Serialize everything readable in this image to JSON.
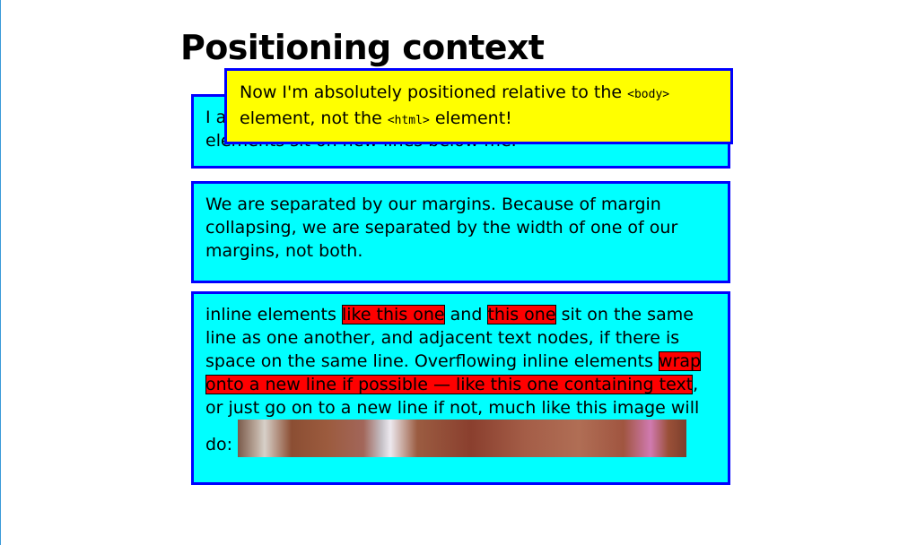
{
  "heading": "Positioning context",
  "block1": {
    "text": "I am a basic block level element. My adjacent block level elements sit on new lines below me."
  },
  "block2": {
    "text": "We are separated by our margins. Because of margin collapsing, we are separated by the width of one of our margins, not both."
  },
  "block3": {
    "t1": "inline elements ",
    "s1": "like this one",
    "t2": " and ",
    "s2": "this one",
    "t3": " sit on the same line as one another, and adjacent text nodes, if there is space on the same line. Overflowing inline elements ",
    "s3": "wrap onto a new line if possible — like this one containing text",
    "t4": ", or just go on to a new line if not, much like this image will do: "
  },
  "positioned": {
    "t1": "Now I'm absolutely positioned relative to the ",
    "c1": "<body>",
    "t2": " element, not the ",
    "c2": "<html>",
    "t3": " element!"
  },
  "colors": {
    "block_bg": "#00ffff",
    "border": "#0000ff",
    "highlight": "#ff0000",
    "positioned_bg": "#ffff00"
  }
}
